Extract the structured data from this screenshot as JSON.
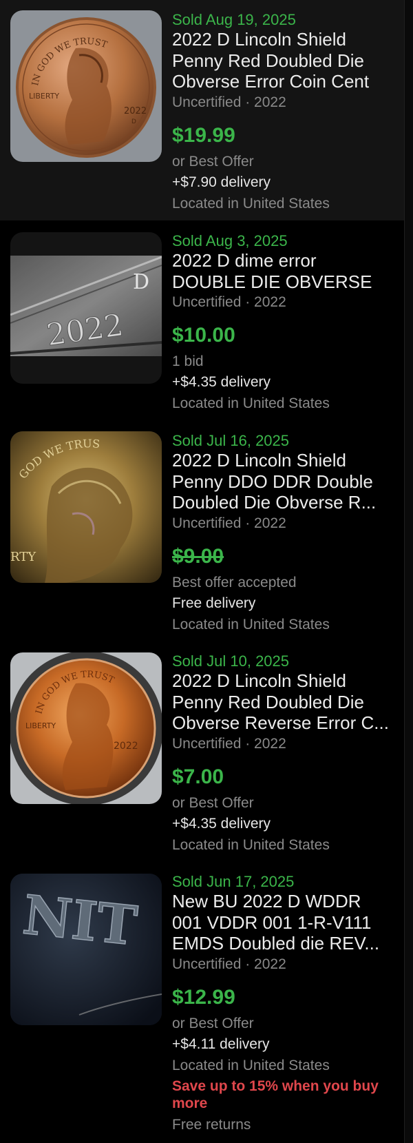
{
  "listings": [
    {
      "sold": "Sold  Aug 19, 2025",
      "title_lines": [
        "2022 D Lincoln Shield",
        "Penny Red Doubled Die",
        "Obverse  Error Coin Cent"
      ],
      "meta": "Uncertified · 2022",
      "price": "$19.99",
      "offer": "or Best Offer",
      "delivery": "+$7.90 delivery",
      "location": "Located in United States",
      "image_text": {
        "top": "IN GOD WE TRUST",
        "left": "LIBERTY",
        "year": "2022",
        "mint": "D"
      }
    },
    {
      "sold": "Sold  Aug 3, 2025",
      "title_lines": [
        "2022 D dime error",
        "DOUBLE DIE OBVERSE"
      ],
      "meta": "Uncertified · 2022",
      "price": "$10.00",
      "offer": "1 bid",
      "delivery": "+$4.35 delivery",
      "location": "Located in United States",
      "image_text": {
        "year": "2022",
        "mint": "D"
      }
    },
    {
      "sold": "Sold  Jul 16, 2025",
      "title_lines": [
        "2022 D Lincoln Shield",
        "Penny DDO DDR Double",
        "Doubled Die Obverse R..."
      ],
      "meta": "Uncertified · 2022",
      "price": "$9.00",
      "offer": "Best offer accepted",
      "delivery": "Free delivery",
      "location": "Located in United States",
      "image_text": {
        "top": "GOD WE TRUS",
        "left": "RTY"
      }
    },
    {
      "sold": "Sold  Jul 10, 2025",
      "title_lines": [
        "2022 D Lincoln Shield",
        "Penny Red Doubled Die",
        "Obverse Reverse Error C..."
      ],
      "meta": "Uncertified · 2022",
      "price": "$7.00",
      "offer": "or Best Offer",
      "delivery": "+$4.35 delivery",
      "location": "Located in United States",
      "image_text": {
        "top": "IN GOD WE TRUST",
        "left": "LIBERTY",
        "year": "2022"
      }
    },
    {
      "sold": "Sold  Jun 17, 2025",
      "title_lines": [
        "New BU 2022 D WDDR",
        "001 VDDR 001 1-R-V111",
        "EMDS Doubled die REV..."
      ],
      "meta": "Uncertified · 2022",
      "price": "$12.99",
      "offer": "or Best Offer",
      "delivery": "+$4.11 delivery",
      "location": "Located in United States",
      "promo": "Save up to 15% when you buy more",
      "returns": "Free returns",
      "image_text": {
        "letters": "NIT"
      }
    }
  ],
  "colors": {
    "sold_green": "#3bb54a",
    "price_green": "#3bb54a",
    "promo_red": "#e0474c",
    "background": "#000000",
    "highlight_row": "#141414"
  }
}
